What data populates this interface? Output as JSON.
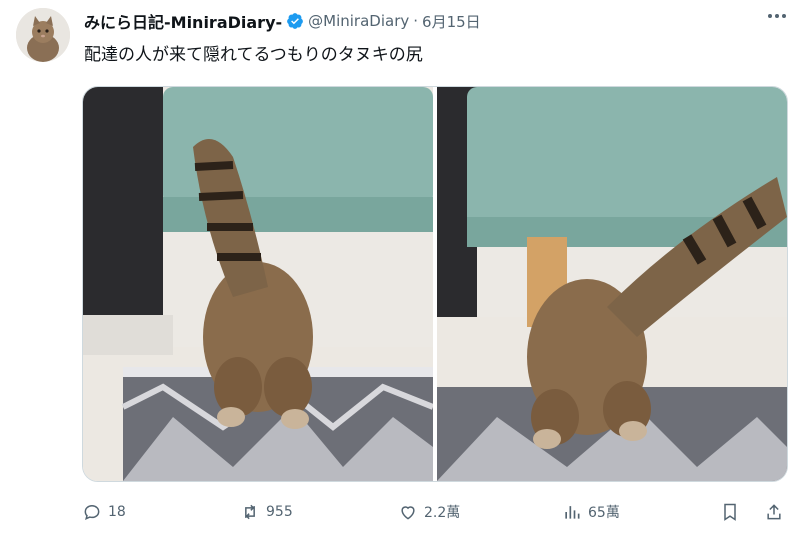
{
  "tweet": {
    "author_name": "みにら日記-MiniraDiary-",
    "handle": "@MiniraDiary",
    "separator": "·",
    "date": "6月15日",
    "verified": true,
    "text": "配達の人が来て隠れてるつもりのタヌキの尻",
    "media_count": 2
  },
  "actions": {
    "replies": "18",
    "retweets": "955",
    "likes": "2.2萬",
    "views": "65萬"
  },
  "icons": [
    "cat-avatar",
    "verified-badge-icon",
    "more-icon",
    "reply-icon",
    "retweet-icon",
    "like-icon",
    "views-icon",
    "bookmark-icon",
    "share-icon"
  ],
  "colors": {
    "text": "#0f1419",
    "secondary": "#536471",
    "verified": "#1d9bf0",
    "border": "#cfd9de"
  }
}
